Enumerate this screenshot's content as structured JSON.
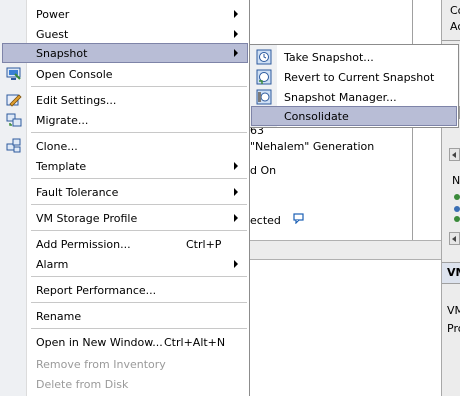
{
  "background": {
    "texts": {
      "t63": "63",
      "nehalem": "\"Nehalem\" Generation",
      "don": "d On",
      "ected": "ected"
    },
    "right_panel": {
      "top1": "Co",
      "top2": "Ac",
      "n_label": "N",
      "vm_label": "VM",
      "vm2_label": "VM",
      "pro_label": "Pro"
    }
  },
  "context_menu": {
    "items": [
      {
        "label": "Power",
        "submenu": true
      },
      {
        "label": "Guest",
        "submenu": true
      },
      {
        "label": "Snapshot",
        "submenu": true,
        "highlighted": true
      },
      {
        "label": "Open Console",
        "icon": "console-icon"
      },
      {
        "label": "Edit Settings...",
        "icon": "edit-settings-icon"
      },
      {
        "label": "Migrate...",
        "icon": "migrate-icon"
      },
      {
        "label": "Clone...",
        "icon": "clone-icon"
      },
      {
        "label": "Template",
        "submenu": true
      },
      {
        "label": "Fault Tolerance",
        "submenu": true
      },
      {
        "label": "VM Storage Profile",
        "submenu": true
      },
      {
        "label": "Add Permission...",
        "shortcut": "Ctrl+P"
      },
      {
        "label": "Alarm",
        "submenu": true
      },
      {
        "label": "Report Performance..."
      },
      {
        "label": "Rename"
      },
      {
        "label": "Open in New Window...",
        "shortcut": "Ctrl+Alt+N"
      },
      {
        "label": "Remove from Inventory",
        "disabled": true
      },
      {
        "label": "Delete from Disk",
        "disabled": true
      }
    ]
  },
  "snapshot_submenu": {
    "items": [
      {
        "label": "Take Snapshot...",
        "icon": "take-snapshot-icon"
      },
      {
        "label": "Revert to Current Snapshot",
        "icon": "revert-snapshot-icon"
      },
      {
        "label": "Snapshot Manager...",
        "icon": "snapshot-manager-icon"
      },
      {
        "label": "Consolidate",
        "highlighted": true
      }
    ]
  },
  "colors": {
    "highlight": "#b8bdd6",
    "highlight_border": "#7e84a8",
    "disabled_text": "#9a9a9a",
    "gutter": "#eef0f3"
  }
}
